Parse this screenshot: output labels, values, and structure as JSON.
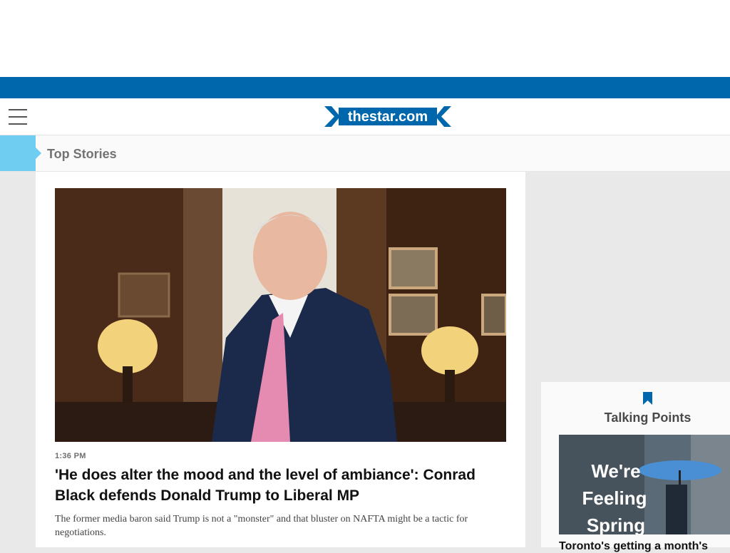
{
  "header": {
    "logo_text": "thestar.com",
    "menu_icon": "hamburger-menu-icon",
    "brand_blue": "#0067ad"
  },
  "section": {
    "title": "Top Stories",
    "accent_color": "#6fcdf1"
  },
  "lead_story": {
    "timestamp": "1:36 PM",
    "headline": "'He does alter the mood and the level of ambiance': Conrad Black defends Donald Trump to Liberal MP",
    "summary": "The former media baron said Trump is not a \"monster\" and that bluster on NAFTA might be a tactic for negotiations."
  },
  "talking_points": {
    "icon": "bookmark-icon",
    "title": "Talking Points",
    "image_text": "We're Feeling Spring",
    "headline": "Toronto's getting a month's"
  }
}
